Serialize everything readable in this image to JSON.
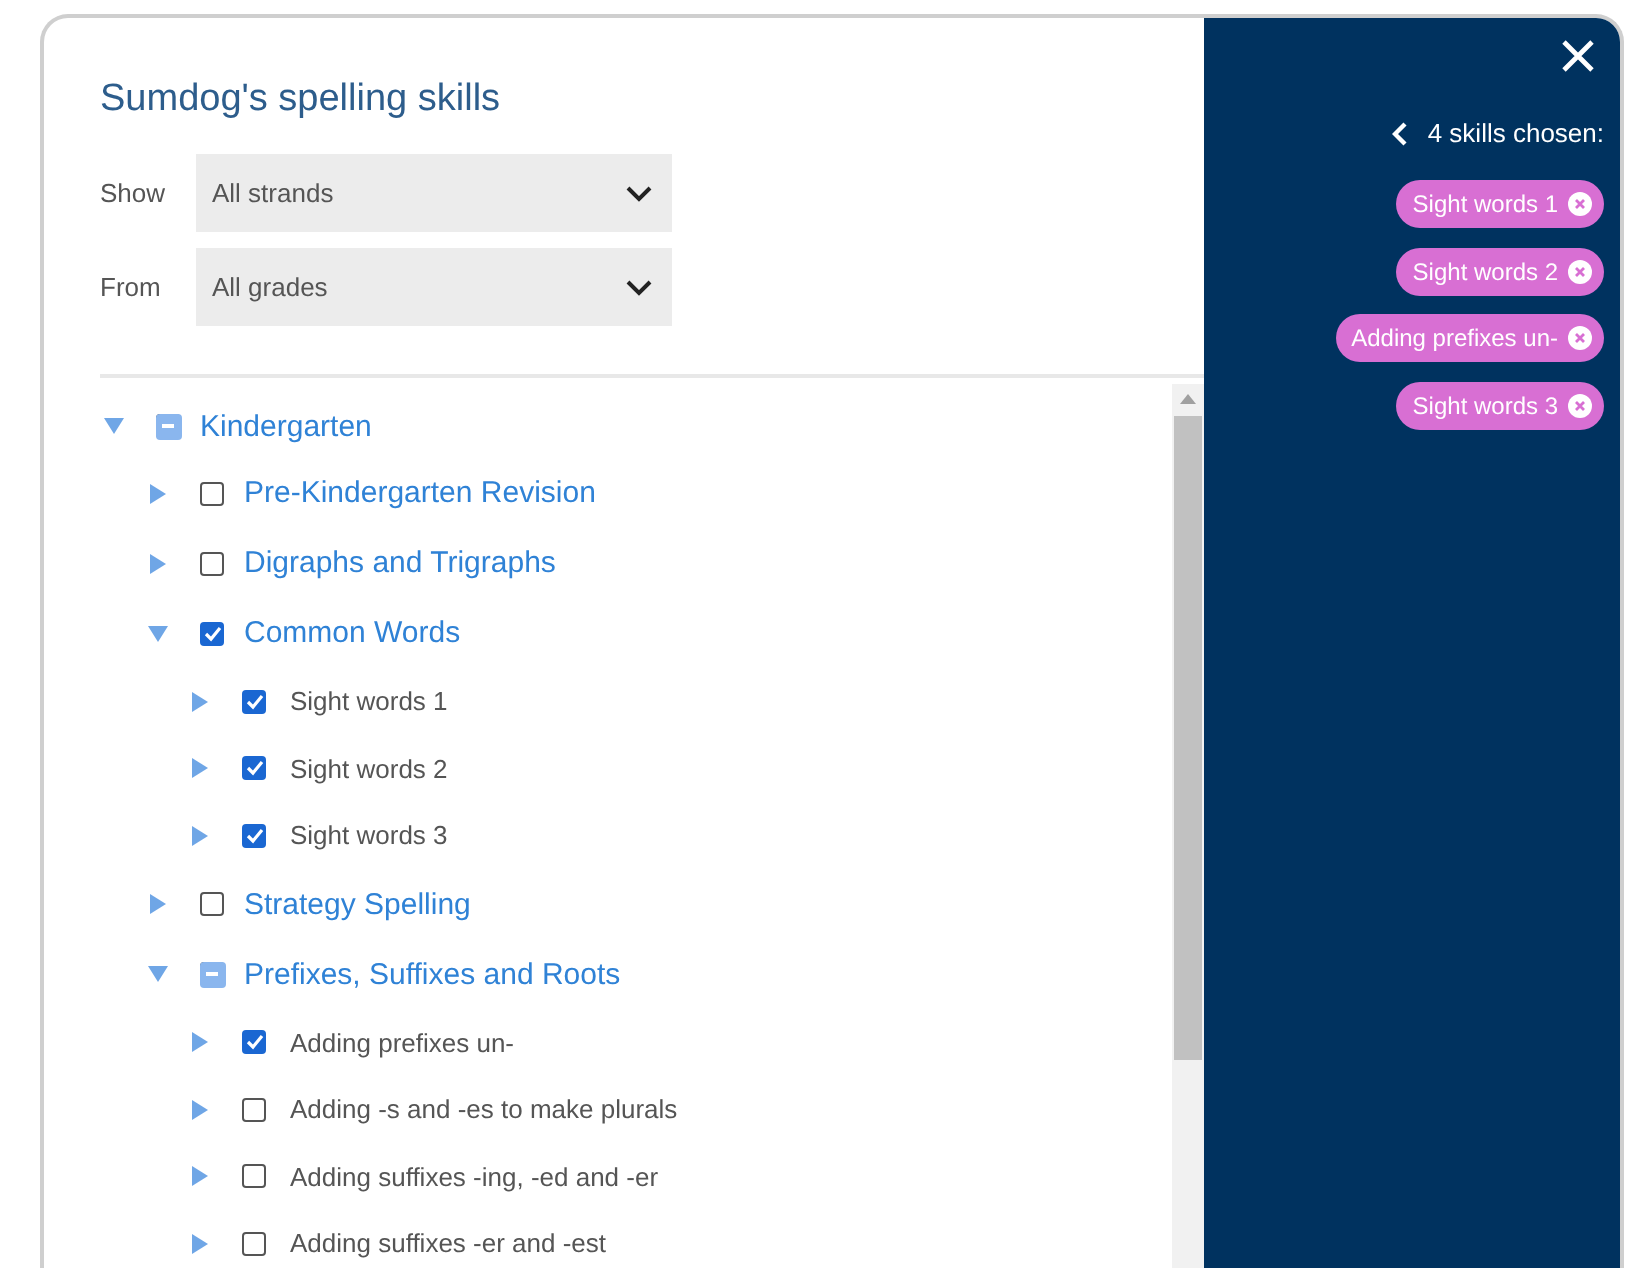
{
  "title": "Sumdog's spelling skills",
  "filters": [
    {
      "label": "Show",
      "value": "All strands"
    },
    {
      "label": "From",
      "value": "All grades"
    }
  ],
  "tree": [
    {
      "label": "Kindergarten",
      "expanded": true,
      "checked": false,
      "partial": true,
      "children": [
        {
          "label": "Pre-Kindergarten Revision",
          "expanded": false,
          "checked": false,
          "partial": false
        },
        {
          "label": "Digraphs and Trigraphs",
          "expanded": false,
          "checked": false,
          "partial": false
        },
        {
          "label": "Common Words",
          "expanded": true,
          "checked": true,
          "partial": false,
          "children": [
            {
              "label": "Sight words 1",
              "expanded": false,
              "checked": true,
              "partial": false
            },
            {
              "label": "Sight words 2",
              "expanded": false,
              "checked": true,
              "partial": false
            },
            {
              "label": "Sight words 3",
              "expanded": false,
              "checked": true,
              "partial": false
            }
          ]
        },
        {
          "label": "Strategy Spelling",
          "expanded": false,
          "checked": false,
          "partial": false
        },
        {
          "label": "Prefixes, Suffixes and Roots",
          "expanded": true,
          "checked": false,
          "partial": true,
          "children": [
            {
              "label": "Adding prefixes un-",
              "expanded": false,
              "checked": true,
              "partial": false
            },
            {
              "label": "Adding -s and -es to make plurals",
              "expanded": false,
              "checked": false,
              "partial": false
            },
            {
              "label": "Adding suffixes -ing, -ed and -er",
              "expanded": false,
              "checked": false,
              "partial": false
            },
            {
              "label": "Adding suffixes -er and -est",
              "expanded": false,
              "checked": false,
              "partial": false
            }
          ]
        }
      ]
    }
  ],
  "chosen": {
    "summary": "4 skills chosen:",
    "skills": [
      "Sight words 1",
      "Sight words 2",
      "Adding prefixes un-",
      "Sight words 3"
    ]
  }
}
